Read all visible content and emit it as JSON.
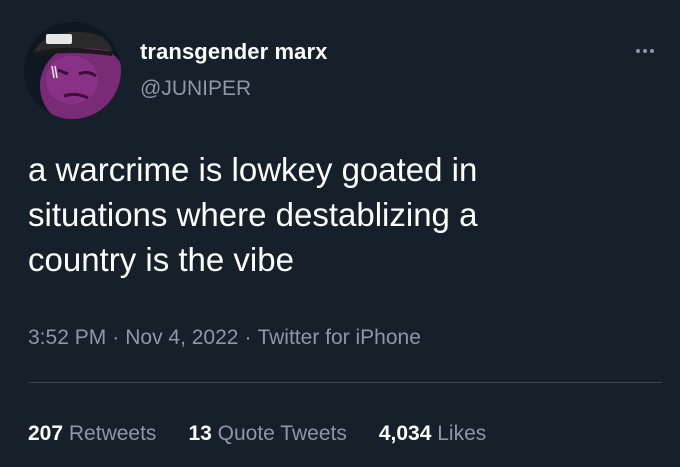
{
  "tweet": {
    "author": {
      "display_name": "transgender marx",
      "handle": "@JUNIPER",
      "avatar_icon": "purple-character-with-cap-avatar"
    },
    "more_icon": "more-options-icon",
    "text": "a warcrime is lowkey goated in\nsituations where destablizing a\ncountry is the vibe",
    "time": "3:52 PM",
    "date": "Nov 4, 2022",
    "source": "Twitter for iPhone",
    "separator": "·",
    "stats": {
      "retweets": {
        "count": "207",
        "label": "Retweets"
      },
      "quote_tweets": {
        "count": "13",
        "label": "Quote Tweets"
      },
      "likes": {
        "count": "4,034",
        "label": "Likes"
      }
    }
  },
  "colors": {
    "background": "#15202b",
    "primary_text": "#ffffff",
    "secondary_text": "#8b98a5",
    "divider": "#38444d"
  }
}
